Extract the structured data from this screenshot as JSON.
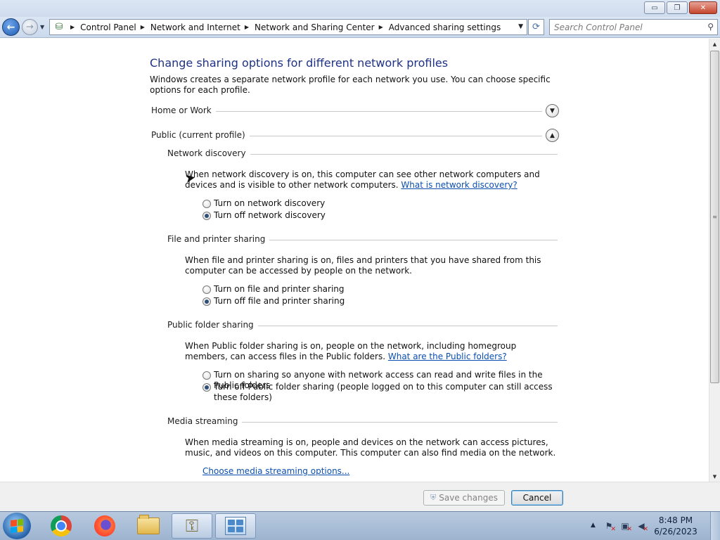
{
  "window": {
    "minimize_glyph": "▭",
    "maximize_glyph": "❐",
    "close_glyph": "✕"
  },
  "nav": {
    "back_glyph": "←",
    "forward_glyph": "→",
    "breadcrumbs": [
      "Control Panel",
      "Network and Internet",
      "Network and Sharing Center",
      "Advanced sharing settings"
    ],
    "search_placeholder": "Search Control Panel"
  },
  "page": {
    "title": "Change sharing options for different network profiles",
    "description": "Windows creates a separate network profile for each network you use. You can choose specific options for each profile."
  },
  "profiles": [
    {
      "label": "Home or Work",
      "expanded": false
    },
    {
      "label": "Public (current profile)",
      "expanded": true
    }
  ],
  "sections": {
    "network_discovery": {
      "title": "Network discovery",
      "text": "When network discovery is on, this computer can see other network computers and devices and is visible to other network computers.",
      "link": "What is network discovery?",
      "options": [
        {
          "label": "Turn on network discovery",
          "selected": false
        },
        {
          "label": "Turn off network discovery",
          "selected": true
        }
      ]
    },
    "file_printer": {
      "title": "File and printer sharing",
      "text": "When file and printer sharing is on, files and printers that you have shared from this computer can be accessed by people on the network.",
      "options": [
        {
          "label": "Turn on file and printer sharing",
          "selected": false
        },
        {
          "label": "Turn off file and printer sharing",
          "selected": true
        }
      ]
    },
    "public_folder": {
      "title": "Public folder sharing",
      "text": "When Public folder sharing is on, people on the network, including homegroup members, can access files in the Public folders.",
      "link": "What are the Public folders?",
      "options": [
        {
          "label": "Turn on sharing so anyone with network access can read and write files in the Public folders",
          "selected": false
        },
        {
          "label": "Turn off Public folder sharing (people logged on to this computer can still access these folders)",
          "selected": true
        }
      ]
    },
    "media_streaming": {
      "title": "Media streaming",
      "text": "When media streaming is on, people and devices on the network can access pictures, music, and videos on this computer. This computer can also find media on the network.",
      "link": "Choose media streaming options..."
    }
  },
  "buttons": {
    "save": "Save changes",
    "cancel": "Cancel"
  },
  "taskbar": {
    "apps": [
      "chrome-icon",
      "firefox-icon",
      "folder-icon",
      "keys-icon",
      "control-panel-icon"
    ],
    "time": "8:48 PM",
    "date": "6/26/2023"
  },
  "colors": {
    "title_blue": "#1e3287",
    "link_blue": "#0a4fb0",
    "taskbar": "#9db4d0"
  }
}
